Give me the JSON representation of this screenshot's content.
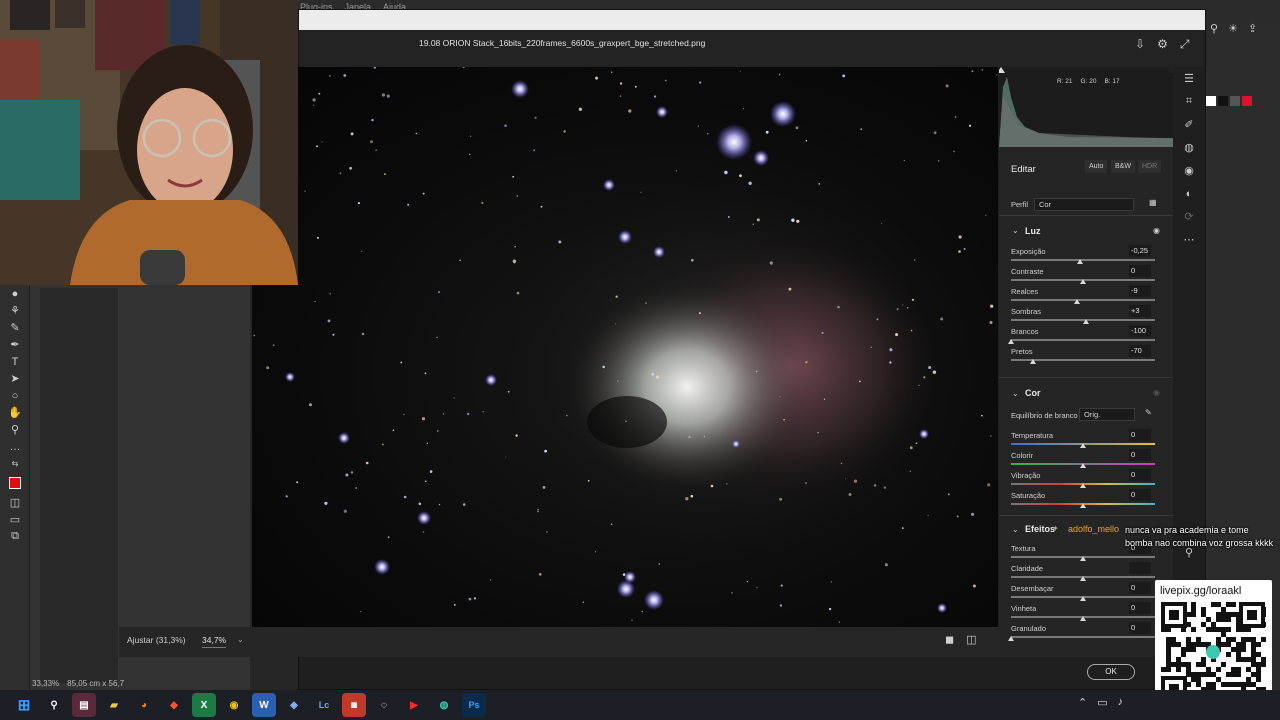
{
  "photoshop": {
    "menu": [
      "Plug-ins",
      "Janela",
      "Ajuda"
    ],
    "zoom_status": "33,33%",
    "doc_size": "85,05 cm x 56,7",
    "tools": [
      "move",
      "marquee",
      "lasso",
      "brush",
      "eraser",
      "pen",
      "type",
      "select",
      "shape",
      "hand",
      "zoom",
      "more"
    ]
  },
  "acr": {
    "filename": "19.08 ORION Stack_16bits_220frames_6600s_graxpert_bge_stretched.png",
    "zoom_fit": "Ajustar (31,3%)",
    "zoom_pct": "34,7%",
    "rgb": {
      "r": "R: 21",
      "g": "G: 20",
      "b": "B: 17"
    },
    "edit_title": "Editar",
    "modes": [
      "Auto",
      "B&W",
      "HDR"
    ],
    "profile_label": "Perfil",
    "profile_value": "Cor",
    "luz": {
      "title": "Luz",
      "rows": [
        {
          "label": "Exposição",
          "value": "-0,25",
          "pos": 0.48
        },
        {
          "label": "Contraste",
          "value": "0",
          "pos": 0.5
        },
        {
          "label": "Realces",
          "value": "-9",
          "pos": 0.46
        },
        {
          "label": "Sombras",
          "value": "+3",
          "pos": 0.52
        },
        {
          "label": "Brancos",
          "value": "-100",
          "pos": 0.0
        },
        {
          "label": "Pretos",
          "value": "-70",
          "pos": 0.15
        }
      ]
    },
    "cor": {
      "title": "Cor",
      "wb_label": "Equilíbrio de branco",
      "wb_value": "Orig.",
      "rows": [
        {
          "label": "Temperatura",
          "value": "0",
          "pos": 0.5
        },
        {
          "label": "Colorir",
          "value": "0",
          "pos": 0.5
        },
        {
          "label": "Vibração",
          "value": "0",
          "pos": 0.5
        },
        {
          "label": "Saturação",
          "value": "0",
          "pos": 0.5
        }
      ]
    },
    "efeitos": {
      "title": "Efeitos",
      "rows": [
        {
          "label": "Textura",
          "value": "0",
          "pos": 0.5
        },
        {
          "label": "Claridade",
          "value": "",
          "pos": 0.5
        },
        {
          "label": "Desembaçar",
          "value": "0",
          "pos": 0.5
        },
        {
          "label": "Vinheta",
          "value": "0",
          "pos": 0.5
        },
        {
          "label": "Granulado",
          "value": "0",
          "pos": 0.0
        }
      ]
    },
    "ok_label": "OK"
  },
  "chat": {
    "user": "adolfo_mello",
    "message": "nunca va pra academia e tome bomba nao combina voz grossa kkkk"
  },
  "qr": {
    "text": "livepix.gg/loraakl"
  },
  "taskbar": {
    "icons": [
      "start",
      "search",
      "app-1",
      "files",
      "firefox",
      "brave",
      "excel",
      "chrome",
      "word",
      "app-2",
      "lc",
      "app-3",
      "app-4",
      "youtube",
      "browser",
      "photoshop"
    ]
  },
  "colors": {
    "accent": "#e8a623",
    "foreground_swatch": "#e01010"
  }
}
